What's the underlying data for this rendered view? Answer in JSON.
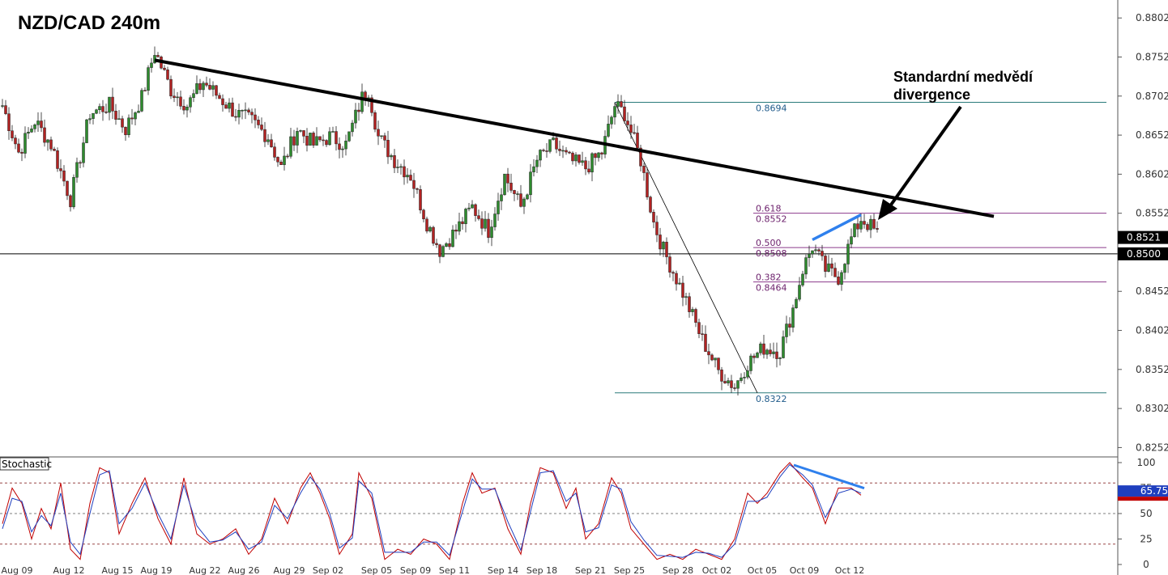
{
  "chart_title": "NZD/CAD 240m",
  "annotation": {
    "line1": "Standardní medvědí",
    "line2": "divergence"
  },
  "stochastic_label": "Stochastic",
  "colors": {
    "up": "#2e8b2e",
    "down": "#b22222",
    "trendline": "#000000",
    "divergence": "#2f80ed",
    "fib": "#8b3a8b",
    "fib_range": "#2a7a7a",
    "stoch_k": "#c00000",
    "stoch_d": "#1f3fbf"
  },
  "chart_data": [
    {
      "type": "candlestick",
      "title": "NZD/CAD 240m",
      "ylim": [
        0.824,
        0.8825
      ],
      "y_ticks": [
        "0.8802",
        "0.8752",
        "0.8702",
        "0.8652",
        "0.8602",
        "0.8552",
        "0.8502",
        "0.8452",
        "0.8402",
        "0.8352",
        "0.8302",
        "0.8252"
      ],
      "x_ticks": [
        {
          "label": "Aug 09",
          "i": 0
        },
        {
          "label": "Aug 12",
          "i": 16
        },
        {
          "label": "Aug 15",
          "i": 31
        },
        {
          "label": "Aug 19",
          "i": 43
        },
        {
          "label": "Aug 22",
          "i": 58
        },
        {
          "label": "Aug 26",
          "i": 70
        },
        {
          "label": "Aug 29",
          "i": 84
        },
        {
          "label": "Sep 02",
          "i": 96
        },
        {
          "label": "Sep 05",
          "i": 111
        },
        {
          "label": "Sep 09",
          "i": 123
        },
        {
          "label": "Sep 11",
          "i": 135
        },
        {
          "label": "Sep 14",
          "i": 150
        },
        {
          "label": "Sep 18",
          "i": 162
        },
        {
          "label": "Sep 21",
          "i": 177
        },
        {
          "label": "Sep 25",
          "i": 189
        },
        {
          "label": "Sep 28",
          "i": 204
        },
        {
          "label": "Oct 02",
          "i": 216
        },
        {
          "label": "Oct 05",
          "i": 230
        },
        {
          "label": "Oct 09",
          "i": 243
        },
        {
          "label": "Oct 12",
          "i": 257
        }
      ],
      "path": [
        [
          0,
          0.869
        ],
        [
          5,
          0.863
        ],
        [
          10,
          0.867
        ],
        [
          15,
          0.864
        ],
        [
          21,
          0.857
        ],
        [
          27,
          0.868
        ],
        [
          33,
          0.869
        ],
        [
          38,
          0.866
        ],
        [
          43,
          0.87
        ],
        [
          47,
          0.876
        ],
        [
          52,
          0.871
        ],
        [
          57,
          0.869
        ],
        [
          62,
          0.872
        ],
        [
          67,
          0.87
        ],
        [
          72,
          0.868
        ],
        [
          77,
          0.867
        ],
        [
          82,
          0.865
        ],
        [
          86,
          0.861
        ],
        [
          91,
          0.866
        ],
        [
          96,
          0.864
        ],
        [
          101,
          0.865
        ],
        [
          106,
          0.864
        ],
        [
          111,
          0.87
        ],
        [
          113,
          0.871
        ],
        [
          116,
          0.865
        ],
        [
          121,
          0.862
        ],
        [
          126,
          0.86
        ],
        [
          131,
          0.854
        ],
        [
          135,
          0.8505
        ],
        [
          140,
          0.853
        ],
        [
          145,
          0.856
        ],
        [
          150,
          0.853
        ],
        [
          155,
          0.86
        ],
        [
          160,
          0.856
        ],
        [
          165,
          0.862
        ],
        [
          170,
          0.864
        ],
        [
          175,
          0.862
        ],
        [
          180,
          0.861
        ],
        [
          185,
          0.863
        ],
        [
          189,
          0.869
        ],
        [
          192,
          0.868
        ],
        [
          197,
          0.862
        ],
        [
          201,
          0.854
        ],
        [
          204,
          0.8505
        ],
        [
          210,
          0.845
        ],
        [
          216,
          0.839
        ],
        [
          221,
          0.835
        ],
        [
          226,
          0.833
        ],
        [
          230,
          0.836
        ],
        [
          235,
          0.838
        ],
        [
          240,
          0.8375
        ],
        [
          244,
          0.843
        ],
        [
          247,
          0.848
        ],
        [
          250,
          0.851
        ],
        [
          254,
          0.848
        ],
        [
          258,
          0.847
        ],
        [
          262,
          0.852
        ],
        [
          265,
          0.8545
        ],
        [
          268,
          0.8535
        ],
        [
          270,
          0.8525
        ]
      ],
      "current_price": "0.8521",
      "horizontal_level": "0.8500",
      "trendline": {
        "from": [
          47,
          0.8748
        ],
        "to": [
          306,
          0.8548
        ]
      },
      "fib_range": {
        "high": 0.8694,
        "low": 0.8322,
        "high_i": 189,
        "low_i": 228,
        "label_high": "0.8694",
        "label_low": "0.8322"
      },
      "fib_levels": [
        {
          "ratio": "0.618",
          "price": "0.8552",
          "value": 0.8552
        },
        {
          "ratio": "0.500",
          "price": "0.8508",
          "value": 0.8508
        },
        {
          "ratio": "0.382",
          "price": "0.8464",
          "value": 0.8464
        }
      ],
      "divergence_price": {
        "from": [
          250,
          0.8518
        ],
        "to": [
          265,
          0.855
        ]
      }
    },
    {
      "type": "line",
      "title": "Stochastic",
      "ylim": [
        0,
        100
      ],
      "y_ticks": [
        "100",
        "75",
        "50",
        "25",
        "0"
      ],
      "levels": [
        80,
        50,
        20
      ],
      "current_value": "65.75",
      "series": [
        {
          "key": "k",
          "values_path": [
            [
              0,
              40
            ],
            [
              3,
              75
            ],
            [
              6,
              60
            ],
            [
              9,
              25
            ],
            [
              12,
              55
            ],
            [
              15,
              35
            ],
            [
              18,
              80
            ],
            [
              21,
              15
            ],
            [
              24,
              5
            ],
            [
              27,
              60
            ],
            [
              30,
              95
            ],
            [
              33,
              90
            ],
            [
              36,
              30
            ],
            [
              40,
              60
            ],
            [
              44,
              85
            ],
            [
              48,
              45
            ],
            [
              52,
              20
            ],
            [
              56,
              85
            ],
            [
              60,
              30
            ],
            [
              64,
              20
            ],
            [
              68,
              25
            ],
            [
              72,
              35
            ],
            [
              76,
              10
            ],
            [
              80,
              25
            ],
            [
              84,
              65
            ],
            [
              88,
              40
            ],
            [
              92,
              75
            ],
            [
              95,
              90
            ],
            [
              98,
              70
            ],
            [
              101,
              45
            ],
            [
              104,
              10
            ],
            [
              108,
              30
            ],
            [
              110,
              90
            ],
            [
              114,
              65
            ],
            [
              118,
              5
            ],
            [
              122,
              15
            ],
            [
              126,
              10
            ],
            [
              130,
              25
            ],
            [
              134,
              20
            ],
            [
              138,
              5
            ],
            [
              142,
              60
            ],
            [
              145,
              90
            ],
            [
              148,
              70
            ],
            [
              152,
              75
            ],
            [
              156,
              35
            ],
            [
              160,
              10
            ],
            [
              163,
              60
            ],
            [
              166,
              95
            ],
            [
              170,
              90
            ],
            [
              174,
              55
            ],
            [
              177,
              75
            ],
            [
              180,
              25
            ],
            [
              184,
              40
            ],
            [
              188,
              85
            ],
            [
              191,
              70
            ],
            [
              194,
              35
            ],
            [
              198,
              20
            ],
            [
              202,
              5
            ],
            [
              206,
              10
            ],
            [
              210,
              5
            ],
            [
              214,
              15
            ],
            [
              218,
              10
            ],
            [
              222,
              5
            ],
            [
              226,
              25
            ],
            [
              230,
              70
            ],
            [
              233,
              60
            ],
            [
              236,
              70
            ],
            [
              240,
              90
            ],
            [
              243,
              100
            ],
            [
              247,
              85
            ],
            [
              250,
              75
            ],
            [
              254,
              40
            ],
            [
              258,
              75
            ],
            [
              262,
              75
            ],
            [
              265,
              68
            ]
          ]
        },
        {
          "key": "d",
          "values_path": [
            [
              0,
              35
            ],
            [
              3,
              65
            ],
            [
              6,
              62
            ],
            [
              9,
              32
            ],
            [
              12,
              48
            ],
            [
              15,
              38
            ],
            [
              18,
              70
            ],
            [
              21,
              22
            ],
            [
              24,
              10
            ],
            [
              27,
              50
            ],
            [
              30,
              88
            ],
            [
              33,
              92
            ],
            [
              36,
              40
            ],
            [
              40,
              55
            ],
            [
              44,
              80
            ],
            [
              48,
              50
            ],
            [
              52,
              25
            ],
            [
              56,
              78
            ],
            [
              60,
              38
            ],
            [
              64,
              22
            ],
            [
              68,
              24
            ],
            [
              72,
              32
            ],
            [
              76,
              15
            ],
            [
              80,
              22
            ],
            [
              84,
              58
            ],
            [
              88,
              45
            ],
            [
              92,
              70
            ],
            [
              95,
              86
            ],
            [
              98,
              74
            ],
            [
              101,
              50
            ],
            [
              104,
              16
            ],
            [
              108,
              26
            ],
            [
              110,
              82
            ],
            [
              114,
              70
            ],
            [
              118,
              12
            ],
            [
              122,
              12
            ],
            [
              126,
              12
            ],
            [
              130,
              22
            ],
            [
              134,
              22
            ],
            [
              138,
              9
            ],
            [
              142,
              52
            ],
            [
              145,
              84
            ],
            [
              148,
              74
            ],
            [
              152,
              74
            ],
            [
              156,
              42
            ],
            [
              160,
              14
            ],
            [
              163,
              52
            ],
            [
              166,
              90
            ],
            [
              170,
              92
            ],
            [
              174,
              62
            ],
            [
              177,
              70
            ],
            [
              180,
              32
            ],
            [
              184,
              36
            ],
            [
              188,
              78
            ],
            [
              191,
              74
            ],
            [
              194,
              42
            ],
            [
              198,
              24
            ],
            [
              202,
              9
            ],
            [
              206,
              8
            ],
            [
              210,
              7
            ],
            [
              214,
              12
            ],
            [
              218,
              11
            ],
            [
              222,
              7
            ],
            [
              226,
              20
            ],
            [
              230,
              62
            ],
            [
              233,
              62
            ],
            [
              236,
              66
            ],
            [
              240,
              86
            ],
            [
              243,
              98
            ],
            [
              247,
              88
            ],
            [
              250,
              78
            ],
            [
              254,
              46
            ],
            [
              258,
              70
            ],
            [
              262,
              74
            ],
            [
              265,
              70
            ]
          ]
        }
      ],
      "divergence": {
        "from": [
          243,
          100
        ],
        "to": [
          265,
          78
        ]
      }
    }
  ]
}
